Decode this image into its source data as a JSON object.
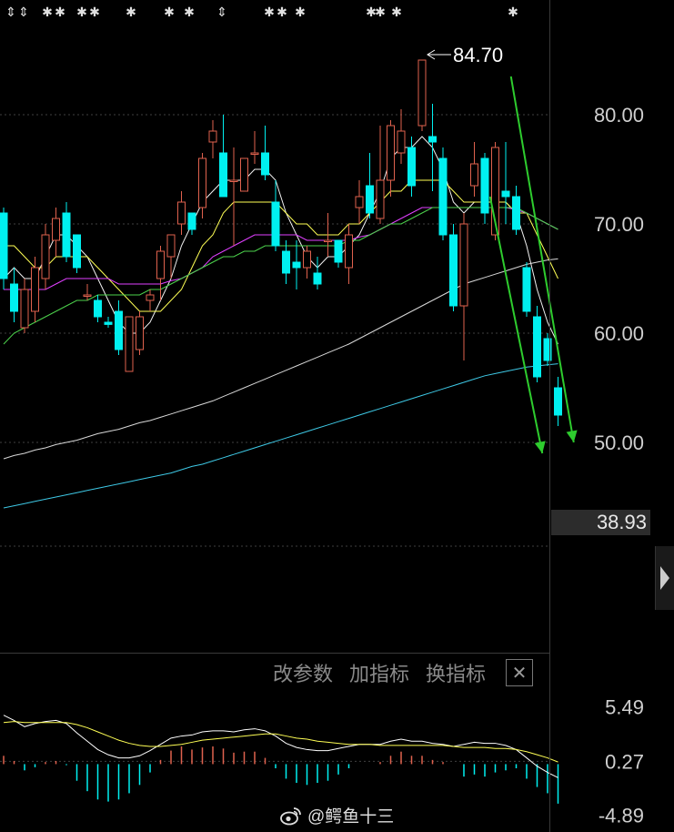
{
  "chart_data": [
    {
      "type": "candlestick",
      "ylim": [
        30.5,
        90.5
      ],
      "y_ticks": [
        "80.00",
        "70.00",
        "60.00",
        "50.00"
      ],
      "peak_annotation": "84.70",
      "current_price": "38.93",
      "candles": [
        {
          "o": 71.0,
          "h": 71.5,
          "l": 64.0,
          "c": 65.0
        },
        {
          "o": 64.5,
          "h": 66.0,
          "l": 61.0,
          "c": 62.0
        },
        {
          "o": 60.5,
          "h": 65.0,
          "l": 60.0,
          "c": 64.0
        },
        {
          "o": 62.0,
          "h": 67.0,
          "l": 61.0,
          "c": 66.0
        },
        {
          "o": 65.0,
          "h": 70.0,
          "l": 64.0,
          "c": 69.0
        },
        {
          "o": 68.5,
          "h": 71.5,
          "l": 67.0,
          "c": 70.5
        },
        {
          "o": 71.0,
          "h": 72.0,
          "l": 66.5,
          "c": 67.0
        },
        {
          "o": 69.0,
          "h": 69.0,
          "l": 65.5,
          "c": 66.0
        },
        {
          "o": 63.5,
          "h": 64.5,
          "l": 63.0,
          "c": 63.5
        },
        {
          "o": 63.0,
          "h": 63.5,
          "l": 61.0,
          "c": 61.5
        },
        {
          "o": 61.0,
          "h": 61.5,
          "l": 60.5,
          "c": 60.8
        },
        {
          "o": 62.0,
          "h": 63.0,
          "l": 58.0,
          "c": 58.5
        },
        {
          "o": 56.5,
          "h": 61.5,
          "l": 56.5,
          "c": 61.5
        },
        {
          "o": 58.5,
          "h": 62.0,
          "l": 58.0,
          "c": 61.5
        },
        {
          "o": 63.0,
          "h": 64.0,
          "l": 62.0,
          "c": 63.5
        },
        {
          "o": 65.0,
          "h": 68.0,
          "l": 63.0,
          "c": 67.5
        },
        {
          "o": 67.0,
          "h": 69.0,
          "l": 65.0,
          "c": 69.0
        },
        {
          "o": 70.0,
          "h": 73.0,
          "l": 69.0,
          "c": 72.0
        },
        {
          "o": 71.0,
          "h": 70.5,
          "l": 69.0,
          "c": 69.5
        },
        {
          "o": 71.5,
          "h": 76.5,
          "l": 70.5,
          "c": 76.0
        },
        {
          "o": 77.5,
          "h": 79.5,
          "l": 76.0,
          "c": 78.5
        },
        {
          "o": 76.5,
          "h": 80.0,
          "l": 76.0,
          "c": 72.5
        },
        {
          "o": 74.0,
          "h": 77.0,
          "l": 68.0,
          "c": 74.0
        },
        {
          "o": 73.0,
          "h": 76.0,
          "l": 73.0,
          "c": 76.0
        },
        {
          "o": 76.5,
          "h": 78.5,
          "l": 75.5,
          "c": 76.5
        },
        {
          "o": 76.5,
          "h": 79.0,
          "l": 74.0,
          "c": 74.5
        },
        {
          "o": 72.0,
          "h": 74.0,
          "l": 67.5,
          "c": 68.0
        },
        {
          "o": 67.5,
          "h": 68.5,
          "l": 64.5,
          "c": 65.5
        },
        {
          "o": 66.5,
          "h": 68.5,
          "l": 64.0,
          "c": 66.0
        },
        {
          "o": 66.0,
          "h": 68.0,
          "l": 65.0,
          "c": 67.5
        },
        {
          "o": 65.5,
          "h": 67.0,
          "l": 64.0,
          "c": 64.5
        },
        {
          "o": 68.5,
          "h": 71.0,
          "l": 67.0,
          "c": 68.5
        },
        {
          "o": 68.5,
          "h": 68.5,
          "l": 66.0,
          "c": 66.5
        },
        {
          "o": 66.0,
          "h": 70.0,
          "l": 64.5,
          "c": 69.0
        },
        {
          "o": 71.5,
          "h": 74.0,
          "l": 70.0,
          "c": 72.5
        },
        {
          "o": 73.5,
          "h": 76.5,
          "l": 70.5,
          "c": 71.0
        },
        {
          "o": 70.5,
          "h": 79.0,
          "l": 70.0,
          "c": 74.0
        },
        {
          "o": 74.0,
          "h": 79.5,
          "l": 72.5,
          "c": 79.0
        },
        {
          "o": 76.5,
          "h": 80.5,
          "l": 75.5,
          "c": 78.5
        },
        {
          "o": 77.0,
          "h": 78.0,
          "l": 72.5,
          "c": 73.5
        },
        {
          "o": 79.0,
          "h": 85.0,
          "l": 78.5,
          "c": 85.0
        },
        {
          "o": 78.0,
          "h": 81.0,
          "l": 73.0,
          "c": 77.5
        },
        {
          "o": 76.0,
          "h": 77.0,
          "l": 68.5,
          "c": 69.0
        },
        {
          "o": 69.0,
          "h": 70.0,
          "l": 62.0,
          "c": 62.5
        },
        {
          "o": 62.5,
          "h": 71.0,
          "l": 57.5,
          "c": 70.0
        },
        {
          "o": 73.5,
          "h": 77.5,
          "l": 72.5,
          "c": 75.5
        },
        {
          "o": 76.0,
          "h": 76.5,
          "l": 70.0,
          "c": 71.0
        },
        {
          "o": 69.0,
          "h": 77.5,
          "l": 68.5,
          "c": 77.0
        },
        {
          "o": 73.0,
          "h": 77.5,
          "l": 70.0,
          "c": 72.5
        },
        {
          "o": 72.5,
          "h": 73.5,
          "l": 69.0,
          "c": 69.5
        },
        {
          "o": 66.0,
          "h": 66.5,
          "l": 61.5,
          "c": 62.0
        },
        {
          "o": 61.5,
          "h": 62.5,
          "l": 55.5,
          "c": 56.0
        },
        {
          "o": 59.5,
          "h": 60.0,
          "l": 57.0,
          "c": 57.5
        },
        {
          "o": 55.0,
          "h": 56.0,
          "l": 51.5,
          "c": 52.5
        }
      ],
      "ma_colors": [
        "#f2f2f2",
        "#ffff55",
        "#e040ff",
        "#4cd24c",
        "#d8d8d8",
        "#3ec9e6"
      ],
      "ma_lines": [
        [
          65,
          66,
          65,
          65,
          67,
          69,
          69,
          68,
          67,
          65,
          63,
          61,
          60,
          60,
          61,
          63,
          65,
          68,
          70,
          72,
          73,
          74,
          74,
          74,
          75,
          75,
          74,
          71,
          69,
          67,
          66,
          67,
          67,
          68,
          69,
          71,
          73,
          76,
          77,
          77,
          78,
          77,
          75,
          72,
          71,
          72,
          72,
          72,
          72,
          71,
          68,
          64,
          61,
          59
        ],
        [
          68,
          68,
          67,
          66,
          66,
          67,
          67,
          67,
          67,
          66,
          65,
          64,
          63,
          62,
          62,
          62,
          63,
          64,
          66,
          68,
          69,
          71,
          72,
          72,
          72,
          72,
          72,
          71,
          70,
          70,
          69,
          69,
          69,
          70,
          70,
          71,
          72,
          73,
          73,
          74,
          74,
          74,
          74,
          73,
          72,
          72,
          72,
          72,
          72,
          71,
          71,
          69,
          67,
          65
        ],
        [
          64,
          64,
          64,
          64,
          64,
          64.5,
          65,
          65,
          65,
          65,
          65,
          64.5,
          64.5,
          64.5,
          64.5,
          64.5,
          64.8,
          65,
          65.5,
          66,
          67,
          67.5,
          68,
          68.5,
          69,
          69,
          69,
          69,
          69,
          68.5,
          68.5,
          68.5,
          68.5,
          68.5,
          68.8,
          69,
          69.5,
          70,
          70.5,
          71,
          71.5,
          71.5,
          71.5,
          71.5,
          71.5,
          71.5,
          71.5,
          71.5,
          71.5,
          71.3,
          71,
          70.5,
          70,
          69.5
        ],
        [
          59,
          60,
          60.5,
          61,
          61.5,
          62,
          62.5,
          63,
          63,
          63.5,
          63.5,
          63.5,
          63.5,
          63.5,
          64,
          64,
          64.5,
          65,
          65.5,
          66,
          66.5,
          67,
          67,
          67.5,
          67.5,
          68,
          68,
          68,
          68,
          68,
          68,
          68,
          68,
          68.5,
          68.5,
          69,
          69.5,
          70,
          70,
          70.5,
          71,
          71.5,
          71.5,
          71.5,
          71.5,
          71.5,
          71.5,
          71.5,
          71.5,
          71.5,
          71,
          70.5,
          70,
          69.5
        ],
        [
          48.5,
          48.8,
          49,
          49.3,
          49.5,
          49.8,
          50,
          50.2,
          50.5,
          50.8,
          51,
          51.2,
          51.5,
          51.8,
          52,
          52.3,
          52.6,
          52.9,
          53.2,
          53.5,
          53.8,
          54.2,
          54.6,
          55,
          55.4,
          55.8,
          56.2,
          56.6,
          57,
          57.4,
          57.8,
          58.2,
          58.6,
          59,
          59.5,
          60,
          60.5,
          61,
          61.5,
          62,
          62.5,
          63,
          63.5,
          64,
          64.5,
          64.8,
          65.1,
          65.4,
          65.7,
          66,
          66.3,
          66.5,
          66.7,
          66.8
        ],
        [
          44,
          44.2,
          44.4,
          44.6,
          44.8,
          45,
          45.2,
          45.4,
          45.6,
          45.8,
          46,
          46.2,
          46.4,
          46.6,
          46.8,
          47,
          47.2,
          47.5,
          47.8,
          48,
          48.3,
          48.6,
          48.9,
          49.2,
          49.5,
          49.8,
          50.1,
          50.4,
          50.7,
          51,
          51.3,
          51.6,
          51.9,
          52.2,
          52.5,
          52.8,
          53.1,
          53.4,
          53.7,
          54,
          54.3,
          54.6,
          54.9,
          55.2,
          55.5,
          55.8,
          56.1,
          56.3,
          56.5,
          56.7,
          56.9,
          57,
          57.1,
          57.2
        ]
      ],
      "trend_arrows": [
        {
          "from": [
            46.5,
            72.5
          ],
          "to": [
            51.5,
            49.0
          ]
        },
        {
          "from": [
            48.5,
            83.5
          ],
          "to": [
            54.5,
            50.0
          ]
        }
      ]
    },
    {
      "type": "macd",
      "ylim": [
        -6.0,
        8.0
      ],
      "y_ticks": [
        "5.49",
        "0.27",
        "-4.89"
      ],
      "dif": [
        4.7,
        4.2,
        3.6,
        3.9,
        4.1,
        4.2,
        3.9,
        3.0,
        2.2,
        1.4,
        0.9,
        0.6,
        0.6,
        0.8,
        1.3,
        1.9,
        2.5,
        2.7,
        2.8,
        3.1,
        3.2,
        3.2,
        3.1,
        3.3,
        3.4,
        3.2,
        2.7,
        2.0,
        1.6,
        1.4,
        1.3,
        1.3,
        1.5,
        1.7,
        1.9,
        1.9,
        1.9,
        2.2,
        2.4,
        2.2,
        2.2,
        2.0,
        1.9,
        1.7,
        1.9,
        2.1,
        2.0,
        2.0,
        1.8,
        1.4,
        0.6,
        -0.2,
        -0.8,
        -1.3
      ],
      "dea": [
        4.0,
        4.1,
        4.0,
        4.0,
        4.0,
        4.0,
        4.0,
        3.8,
        3.5,
        3.1,
        2.7,
        2.3,
        2.0,
        1.8,
        1.7,
        1.7,
        1.8,
        1.9,
        2.1,
        2.3,
        2.4,
        2.5,
        2.6,
        2.7,
        2.8,
        2.9,
        2.9,
        2.7,
        2.5,
        2.4,
        2.2,
        2.1,
        2.0,
        1.9,
        1.9,
        1.9,
        1.8,
        1.8,
        1.8,
        1.8,
        1.8,
        1.8,
        1.8,
        1.7,
        1.6,
        1.6,
        1.6,
        1.5,
        1.5,
        1.4,
        1.2,
        0.9,
        0.6,
        0.2
      ],
      "hist": [
        0.8,
        0.3,
        -0.6,
        -0.3,
        0.2,
        0.3,
        -0.1,
        -1.6,
        -2.6,
        -3.4,
        -3.6,
        -3.4,
        -2.8,
        -2.0,
        -0.8,
        0.4,
        1.3,
        1.7,
        1.4,
        1.6,
        1.7,
        1.5,
        1.1,
        1.2,
        1.2,
        0.6,
        -0.4,
        -1.4,
        -1.8,
        -2.0,
        -1.8,
        -1.6,
        -1.0,
        -0.4,
        0.0,
        0.0,
        0.2,
        0.8,
        1.2,
        0.8,
        0.8,
        0.4,
        0.2,
        0.0,
        -1.2,
        -1.0,
        -1.2,
        -0.8,
        -0.6,
        -0.4,
        -1.4,
        -2.2,
        -2.8,
        -3.8
      ]
    }
  ],
  "top_markers": [
    "⇕",
    "⇕",
    "✱",
    "✱",
    "✱",
    "✱",
    "✱",
    "✱",
    "✱",
    "✱",
    "⇕",
    "✱",
    "✱",
    "✱",
    "✱",
    "✱",
    "✱"
  ],
  "indicator_toolbar": {
    "modify_params": "改参数",
    "add_indicator": "加指标",
    "swap_indicator": "换指标",
    "close": "✕"
  },
  "watermark": {
    "text": "@鳄鱼十三"
  },
  "colors": {
    "up": "#e0624e",
    "down": "#00f0f0",
    "grid": "#404040",
    "axis_text": "#cfcfcf",
    "arrow": "#2ecc2e",
    "dif": "#ffffff",
    "dea": "#ffff55"
  }
}
